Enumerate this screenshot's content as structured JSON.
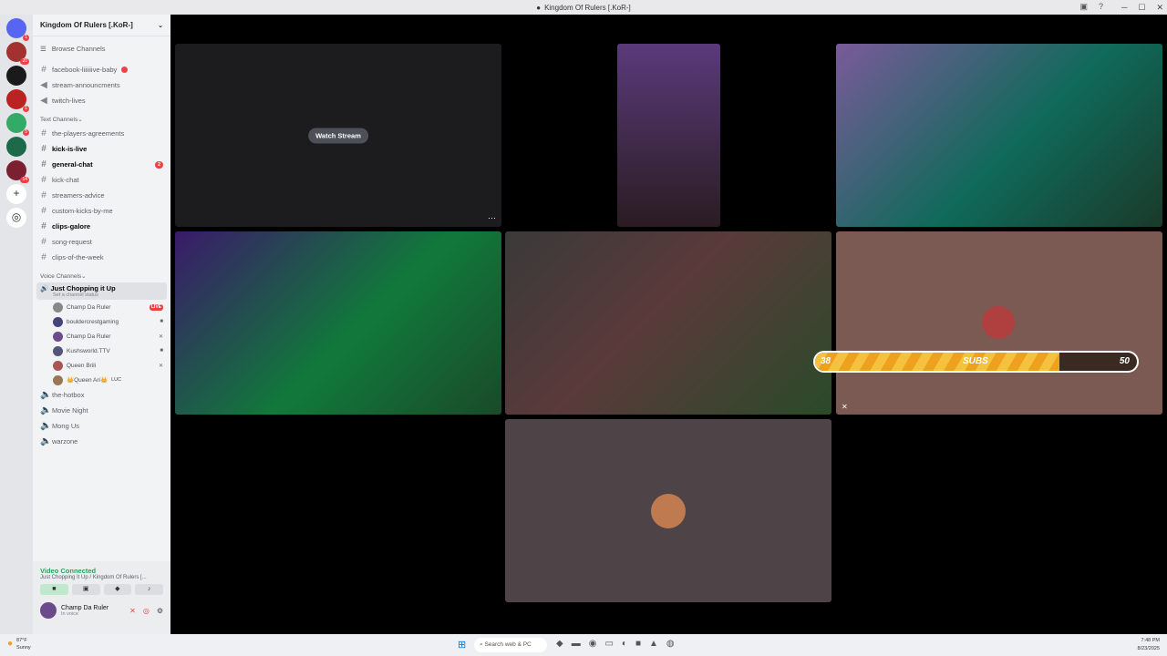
{
  "window": {
    "title": "Kingdom Of Rulers [.KoR-]"
  },
  "servers": {
    "badges": [
      "1",
      "20",
      "1",
      "5",
      "1",
      "14"
    ]
  },
  "guild": {
    "name": "Kingdom Of Rulers [.KoR-]",
    "browse": "Browse Channels"
  },
  "channels": {
    "pinned": [
      {
        "label": "facebook-liiiiiive-baby",
        "icon": "hash-icon"
      },
      {
        "label": "stream-announcments",
        "icon": "announce-icon"
      },
      {
        "label": "twitch-lives",
        "icon": "announce-icon"
      }
    ],
    "text_category": "Text Channels",
    "text": [
      {
        "label": "the-players-agreements",
        "unread": false,
        "count": ""
      },
      {
        "label": "kick-is-live",
        "unread": true,
        "count": ""
      },
      {
        "label": "general-chat",
        "unread": true,
        "count": "2"
      },
      {
        "label": "kick-chat",
        "unread": false,
        "count": ""
      },
      {
        "label": "streamers-advice",
        "unread": false,
        "count": ""
      },
      {
        "label": "custom-kicks-by-me",
        "unread": false,
        "count": ""
      },
      {
        "label": "clips-galore",
        "unread": true,
        "count": ""
      },
      {
        "label": "song-request",
        "unread": false,
        "count": ""
      },
      {
        "label": "clips-of-the-week",
        "unread": false,
        "count": ""
      }
    ],
    "voice_category": "Voice Channels",
    "active_voice": {
      "name": "Just Chopping it Up",
      "status": "Set a channel status"
    },
    "voice_users": [
      {
        "name": "Champ Da Ruler",
        "badge": "LIVE"
      },
      {
        "name": "bouldercrestgaming",
        "badge": ""
      },
      {
        "name": "Champ Da Ruler",
        "badge": ""
      },
      {
        "name": "Kushsworld.TTV",
        "badge": ""
      },
      {
        "name": "Queen Brili",
        "badge": ""
      },
      {
        "name": "👑Queen Ari👑",
        "badge": "LUC"
      }
    ],
    "voice": [
      "the-hotbox",
      "Movie Night",
      "Mong Us",
      "warzone"
    ]
  },
  "panel": {
    "state": "Video Connected",
    "where": "Just Chopping It Up / Kingdom Of Rulers [...",
    "user": "Champ Da Ruler",
    "user_status": "In voice"
  },
  "stage": {
    "watch_label": "Watch Stream"
  },
  "subs_bar": {
    "current": "38",
    "label": "SUBS",
    "goal": "50",
    "progress": 0.76
  },
  "taskbar": {
    "weather_temp": "87°F",
    "weather_desc": "Sunny",
    "search": "Search web & PC",
    "time": "7:48 PM",
    "date": "8/23/2025"
  },
  "colors": {
    "live": "#ed4245",
    "connected": "#23a55a",
    "bar": "#f0a020"
  }
}
